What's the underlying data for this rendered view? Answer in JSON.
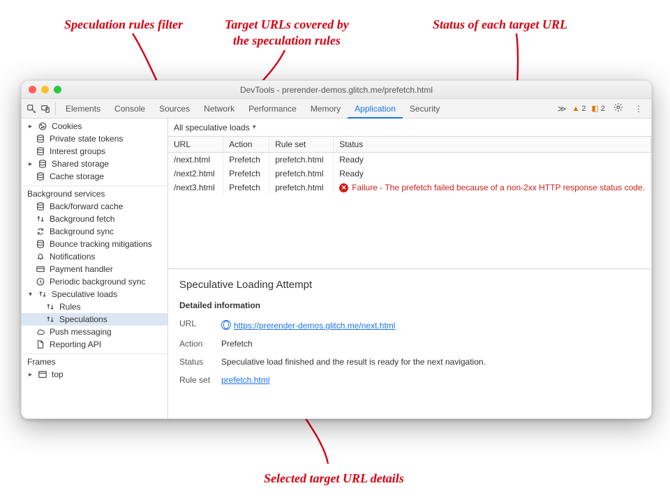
{
  "annotations": {
    "filter": "Speculation rules filter",
    "targets": "Target URLs covered by\nthe speculation rules",
    "status": "Status of each target URL",
    "details": "Selected target URL details"
  },
  "window": {
    "title": "DevTools - prerender-demos.glitch.me/prefetch.html"
  },
  "toolbar": {
    "tabs": [
      "Elements",
      "Console",
      "Sources",
      "Network",
      "Performance",
      "Memory",
      "Application",
      "Security"
    ],
    "active": "Application",
    "warnings": "2",
    "flags": "2"
  },
  "sidebar": {
    "items": [
      {
        "label": "Cookies",
        "icon": "cookie",
        "expandable": true
      },
      {
        "label": "Private state tokens",
        "icon": "db"
      },
      {
        "label": "Interest groups",
        "icon": "db"
      },
      {
        "label": "Shared storage",
        "icon": "db",
        "expandable": true
      },
      {
        "label": "Cache storage",
        "icon": "db"
      }
    ],
    "bg_heading": "Background services",
    "bg": [
      {
        "label": "Back/forward cache",
        "icon": "db"
      },
      {
        "label": "Background fetch",
        "icon": "updown"
      },
      {
        "label": "Background sync",
        "icon": "sync"
      },
      {
        "label": "Bounce tracking mitigations",
        "icon": "db"
      },
      {
        "label": "Notifications",
        "icon": "bell"
      },
      {
        "label": "Payment handler",
        "icon": "card"
      },
      {
        "label": "Periodic background sync",
        "icon": "clock"
      },
      {
        "label": "Speculative loads",
        "icon": "updown",
        "expandable": true,
        "open": true
      },
      {
        "label": "Rules",
        "icon": "updown",
        "level": 2
      },
      {
        "label": "Speculations",
        "icon": "updown",
        "level": 2,
        "selected": true
      },
      {
        "label": "Push messaging",
        "icon": "cloud"
      },
      {
        "label": "Reporting API",
        "icon": "file"
      }
    ],
    "frames_heading": "Frames",
    "frames": [
      {
        "label": "top",
        "icon": "window",
        "expandable": true
      }
    ]
  },
  "content": {
    "filter_label": "All speculative loads",
    "columns": [
      "URL",
      "Action",
      "Rule set",
      "Status"
    ],
    "rows": [
      {
        "url": "/next.html",
        "action": "Prefetch",
        "ruleset": "prefetch.html",
        "status": "Ready",
        "fail": false
      },
      {
        "url": "/next2.html",
        "action": "Prefetch",
        "ruleset": "prefetch.html",
        "status": "Ready",
        "fail": false
      },
      {
        "url": "/next3.html",
        "action": "Prefetch",
        "ruleset": "prefetch.html",
        "status": "Failure - The prefetch failed because of a non-2xx HTTP response status code.",
        "fail": true
      }
    ]
  },
  "detail": {
    "title": "Speculative Loading Attempt",
    "section": "Detailed information",
    "url_label": "URL",
    "url_value": "https://prerender-demos.glitch.me/next.html",
    "action_label": "Action",
    "action_value": "Prefetch",
    "status_label": "Status",
    "status_value": "Speculative load finished and the result is ready for the next navigation.",
    "ruleset_label": "Rule set",
    "ruleset_value": "prefetch.html"
  }
}
